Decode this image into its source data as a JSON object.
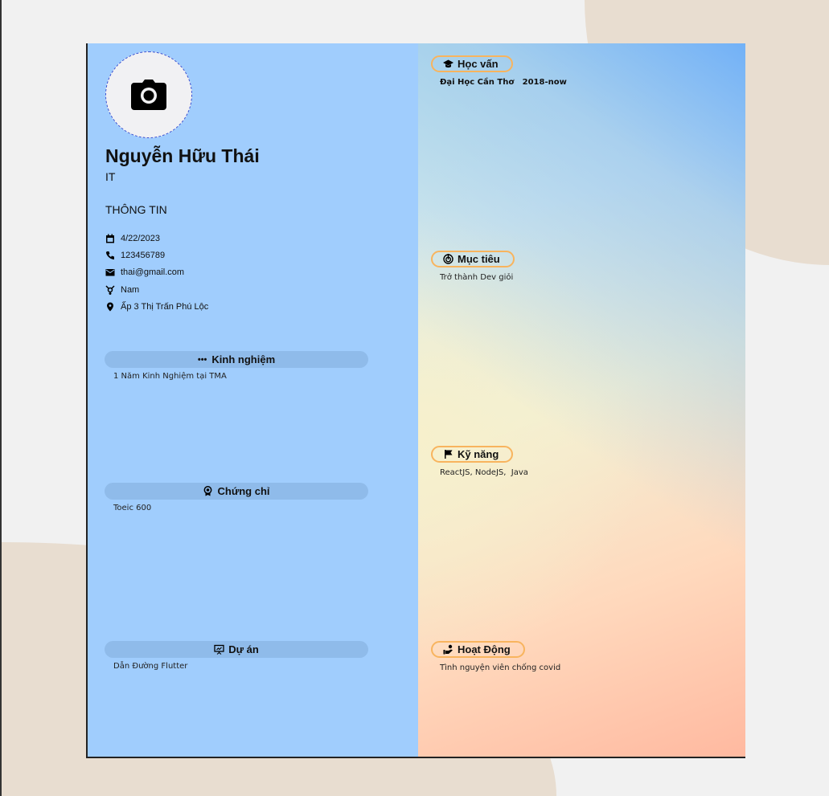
{
  "profile": {
    "name": "Nguyễn Hữu Thái",
    "role": "IT"
  },
  "info": {
    "heading": "THÔNG TIN",
    "birthday": "4/22/2023",
    "phone": "123456789",
    "email": "thai@gmail.com",
    "gender": "Nam",
    "address": "Ấp 3 Thị Trấn Phú Lộc"
  },
  "left_sections": [
    {
      "title": "Kinh nghiệm",
      "text": "1 Năm Kinh Nghiệm tại TMA",
      "icon": "dots-icon"
    },
    {
      "title": "Chứng chỉ",
      "text": "Toeic 600",
      "icon": "award-icon"
    },
    {
      "title": "Dự án",
      "text": "Dẫn Đường Flutter",
      "icon": "presentation-icon"
    }
  ],
  "right_sections": [
    {
      "title": "Học vấn",
      "text": "Đại Học Cần Thơ   2018-now",
      "icon": "graduation-cap-icon"
    },
    {
      "title": "Mục tiêu",
      "text": "Trở thành Dev giỏi",
      "icon": "target-icon"
    },
    {
      "title": "Kỹ năng",
      "text": "ReactJS, NodeJS,  Java",
      "icon": "flag-icon"
    },
    {
      "title": "Hoạt Động",
      "text": "Tình nguyện viên chống covid",
      "icon": "volunteer-icon"
    }
  ],
  "colors": {
    "left_bg": "#a0cdfd",
    "pill_border": "#f8b45e",
    "section_bar": "#8fbbea"
  }
}
